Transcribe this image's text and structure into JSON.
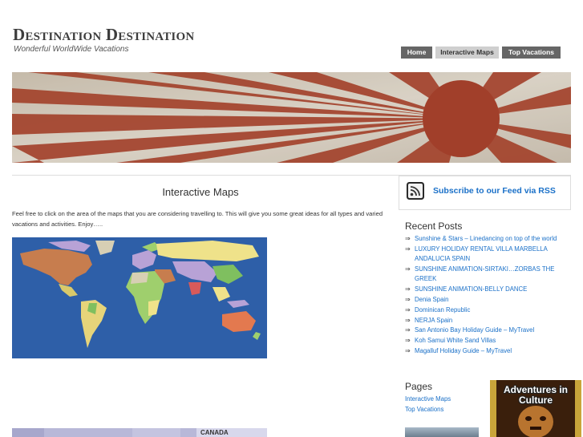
{
  "site": {
    "title": "Destination Destination",
    "tagline": "Wonderful WorldWide Vacations"
  },
  "nav": {
    "items": [
      {
        "label": "Home"
      },
      {
        "label": "Interactive Maps"
      },
      {
        "label": "Top Vacations"
      }
    ],
    "active": "Interactive Maps"
  },
  "banner": {
    "image": "rising-sun-flag",
    "colors": {
      "sun": "#b4452e",
      "ray": "#b54a33",
      "background": "#e9e2d2"
    }
  },
  "main": {
    "title": "Interactive Maps",
    "intro": "Feel free to click on the area of the maps that you are considering travelling to. This will give you some great ideas for all types and varied vacations and activities. Enjoy…..",
    "map1": {
      "image": "world-map",
      "ocean_color": "#2e5fa8"
    },
    "map2": {
      "image": "north-america-map",
      "label": "CANADA"
    }
  },
  "sidebar": {
    "rss_label": "Subscribe to our Feed via RSS",
    "recent_heading": "Recent Posts",
    "recent_posts": [
      "Sunshine & Stars – Linedancing on top of the world",
      "LUXURY HOLIDAY RENTAL VILLA MARBELLA ANDALUCIA SPAIN",
      "SUNSHINE ANIMATION-SIRTAKI…ZORBAS THE GREEK",
      "SUNSHINE ANIMATION-BELLY DANCE",
      "Denia Spain",
      "Dominican Republic",
      "NERJA Spain",
      "San Antonio Bay Holiday Guide – MyTravel",
      "Koh Samui White Sand Villas",
      "Magalluf Holiday Guide – MyTravel"
    ],
    "pages_heading": "Pages",
    "pages": [
      "Interactive Maps",
      "Top Vacations"
    ],
    "ad_text": "Adventures in Culture"
  },
  "colors": {
    "link": "#1a70c8",
    "nav_bg": "#666666",
    "nav_active_bg": "#cfcfcf"
  }
}
